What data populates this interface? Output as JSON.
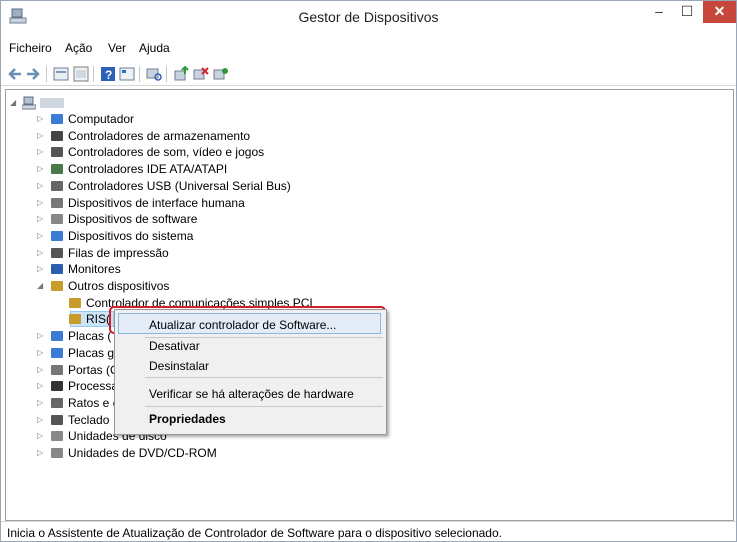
{
  "window": {
    "title": "Gestor de Dispositivos",
    "min": "–",
    "max": "☐",
    "close": "✕"
  },
  "menu": [
    "Ficheiro",
    "Ação",
    "Ver",
    "Ajuda"
  ],
  "toolbar": {
    "icons": [
      "back-icon",
      "forward-icon",
      "properties-icon",
      "view-icon",
      "help-icon",
      "device-view-icon",
      "scan-hardware-icon",
      "update-driver-icon",
      "uninstall-icon",
      "enable-icon"
    ]
  },
  "tree": {
    "items": [
      "Computador",
      "Controladores de armazenamento",
      "Controladores de som, vídeo e jogos",
      "Controladores IDE ATA/ATAPI",
      "Controladores USB (Universal Serial Bus)",
      "Dispositivos de interface humana",
      "Dispositivos de software",
      "Dispositivos do sistema",
      "Filas de impressão",
      "Monitores",
      "Outros dispositivos",
      "Controlador de comunicações simples PCI",
      "RIS(",
      "Placas (",
      "Placas g",
      "Portas (C",
      "Processa",
      "Ratos e c",
      "Teclado",
      "Unidades de disco",
      "Unidades de DVD/CD-ROM"
    ]
  },
  "context_menu": {
    "items": [
      "Atualizar controlador de Software...",
      "Desativar",
      "Desinstalar",
      "Verificar se há alterações de hardware",
      "Propriedades"
    ]
  },
  "status": "Inicia o Assistente de Atualização de Controlador de Software para o dispositivo selecionado."
}
